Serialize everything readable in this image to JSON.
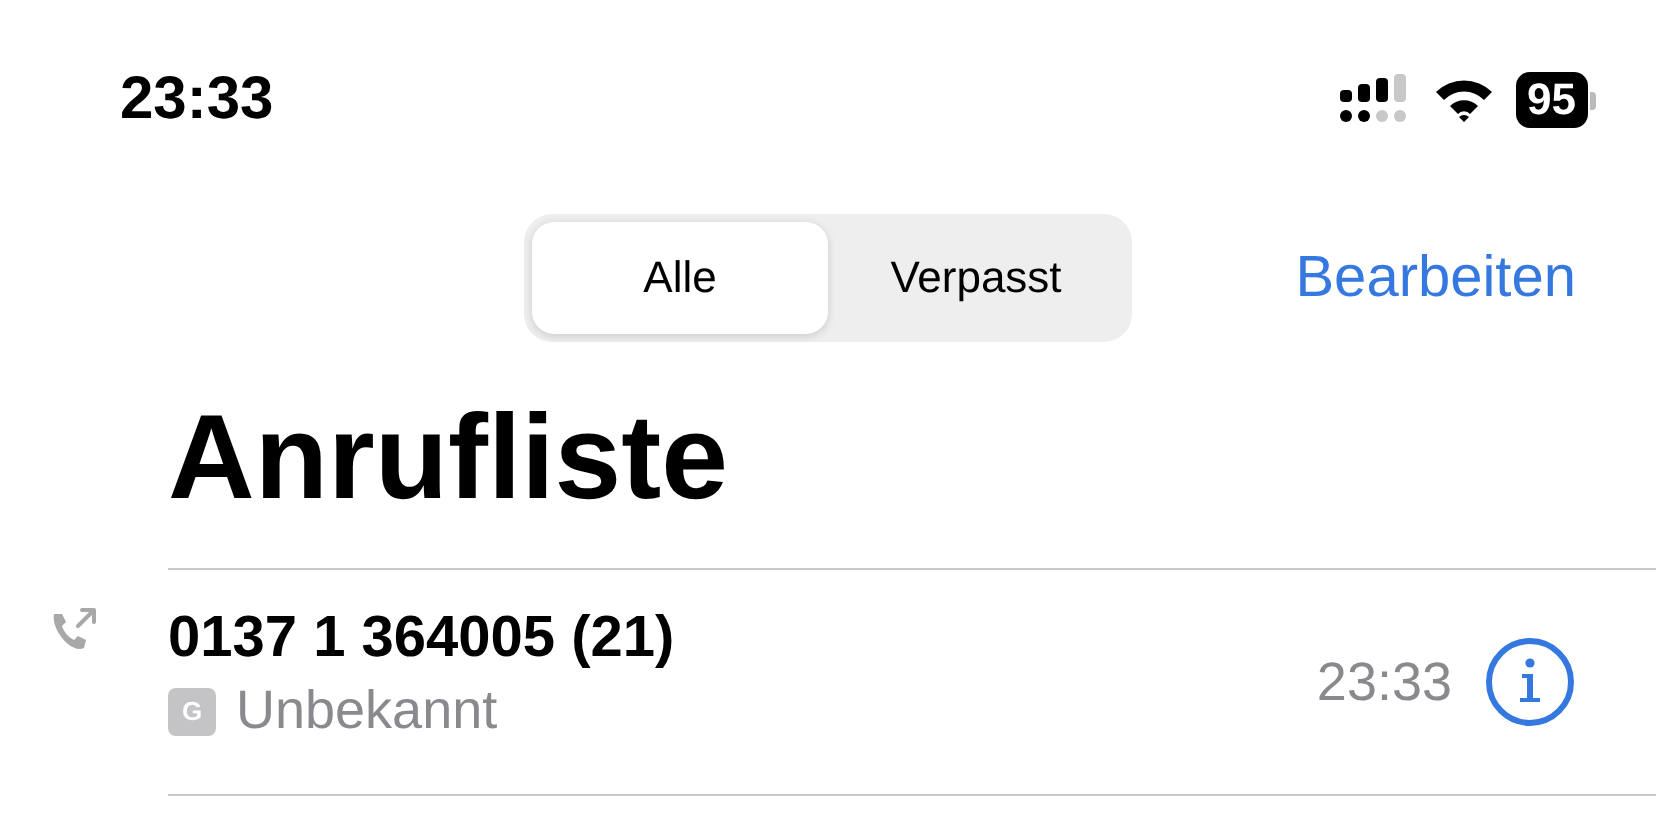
{
  "status_bar": {
    "time": "23:33",
    "battery": "95"
  },
  "segments": [
    {
      "label": "Alle",
      "selected": true
    },
    {
      "label": "Verpasst",
      "selected": false
    }
  ],
  "edit_button": "Bearbeiten",
  "title": "Anrufliste",
  "calls": [
    {
      "number": "0137 1 364005 (21)",
      "badge": "G",
      "label": "Unbekannt",
      "time": "23:33"
    }
  ]
}
